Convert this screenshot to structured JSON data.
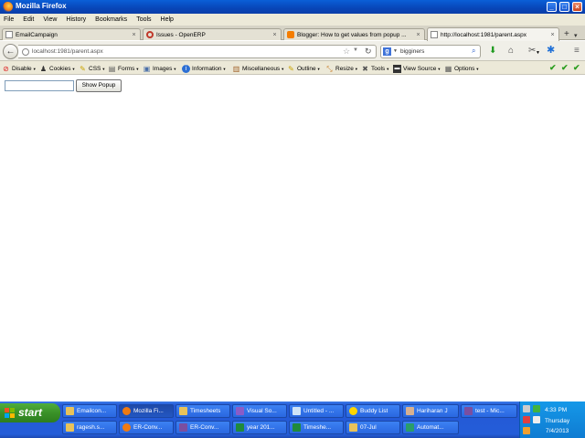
{
  "window": {
    "title": "Mozilla Firefox"
  },
  "menu": [
    "File",
    "Edit",
    "View",
    "History",
    "Bookmarks",
    "Tools",
    "Help"
  ],
  "tabs": [
    {
      "label": "EmailCampaign",
      "active": false
    },
    {
      "label": "Issues - OpenERP",
      "active": false
    },
    {
      "label": "Blogger: How to get values from popup ...",
      "active": false
    },
    {
      "label": "http://localhost:1981/parent.aspx",
      "active": true
    }
  ],
  "nav": {
    "url": "localhost:1981/parent.aspx",
    "search_engine": "g",
    "search_value": "bigginers"
  },
  "devtoolbar": [
    "Disable",
    "Cookies",
    "CSS",
    "Forms",
    "Images",
    "Information",
    "Miscellaneous",
    "Outline",
    "Resize",
    "Tools",
    "View Source",
    "Options"
  ],
  "page": {
    "textbox_value": "",
    "button_label": "Show Popup"
  },
  "taskbar": {
    "start_label": "start",
    "row1": [
      "Emailcon...",
      "Mozilla Fi...",
      "Timesheets",
      "Visual So...",
      "Untitled - ...",
      "Buddy List",
      "Hariharan J",
      "test - Mic..."
    ],
    "row2": [
      "ragesh.s...",
      "ER-Conv...",
      "ER-Conv...",
      "year 201...",
      "Timeshe...",
      "07-Jul",
      "Automat..."
    ],
    "time": "4:33 PM",
    "day": "Thursday",
    "date": "7/4/2013"
  },
  "colors": {
    "titlebar": "#0a5fd8",
    "taskbar": "#245dd8",
    "start": "#3a9128",
    "tray": "#0f7cd2"
  }
}
